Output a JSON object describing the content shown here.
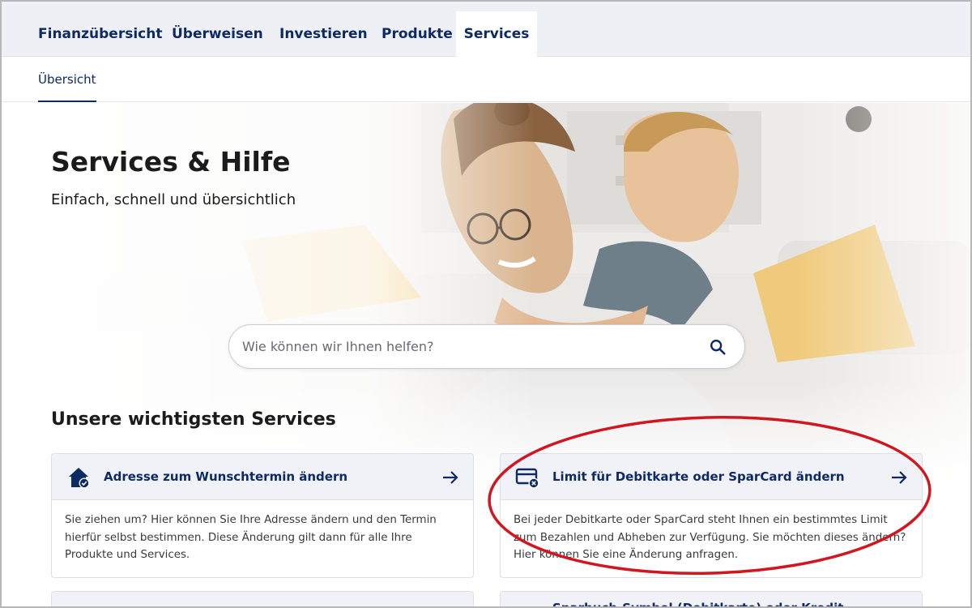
{
  "nav": {
    "tabs": [
      {
        "label": "Finanzübersicht"
      },
      {
        "label": "Überweisen"
      },
      {
        "label": "Investieren"
      },
      {
        "label": "Produkte"
      },
      {
        "label": "Services",
        "active": true
      }
    ]
  },
  "subnav": {
    "label": "Übersicht"
  },
  "hero": {
    "title": "Services & Hilfe",
    "subtitle": "Einfach, schnell und übersichtlich"
  },
  "search": {
    "placeholder": "Wie können wir Ihnen helfen?",
    "icon": "search-icon"
  },
  "services": {
    "title": "Unsere wichtigsten Services",
    "cards": [
      {
        "title": "Adresse zum Wunschtermin ändern",
        "icon": "house-check-icon",
        "text": "Sie ziehen um? Hier können Sie Ihre Adresse ändern und den Termin hierfür selbst bestimmen. Diese Änderung gilt dann für alle Ihre Produkte und Services."
      },
      {
        "title": "Limit für Debitkarte oder SparCard ändern",
        "icon": "card-limit-icon",
        "text": "Bei jeder Debitkarte oder SparCard steht Ihnen ein bestimmtes Limit zum Bezahlen und Abheben zur Verfügung. Sie möchten dieses ändern? Hier können Sie eine Änderung anfragen."
      }
    ],
    "partial_card": {
      "title": "Sparbuch-Symbol (Debitkarte) oder Kredit..."
    }
  },
  "colors": {
    "brand_navy": "#0d2a63",
    "nav_background": "#eef0f6",
    "highlight_red": "#d0161f"
  }
}
